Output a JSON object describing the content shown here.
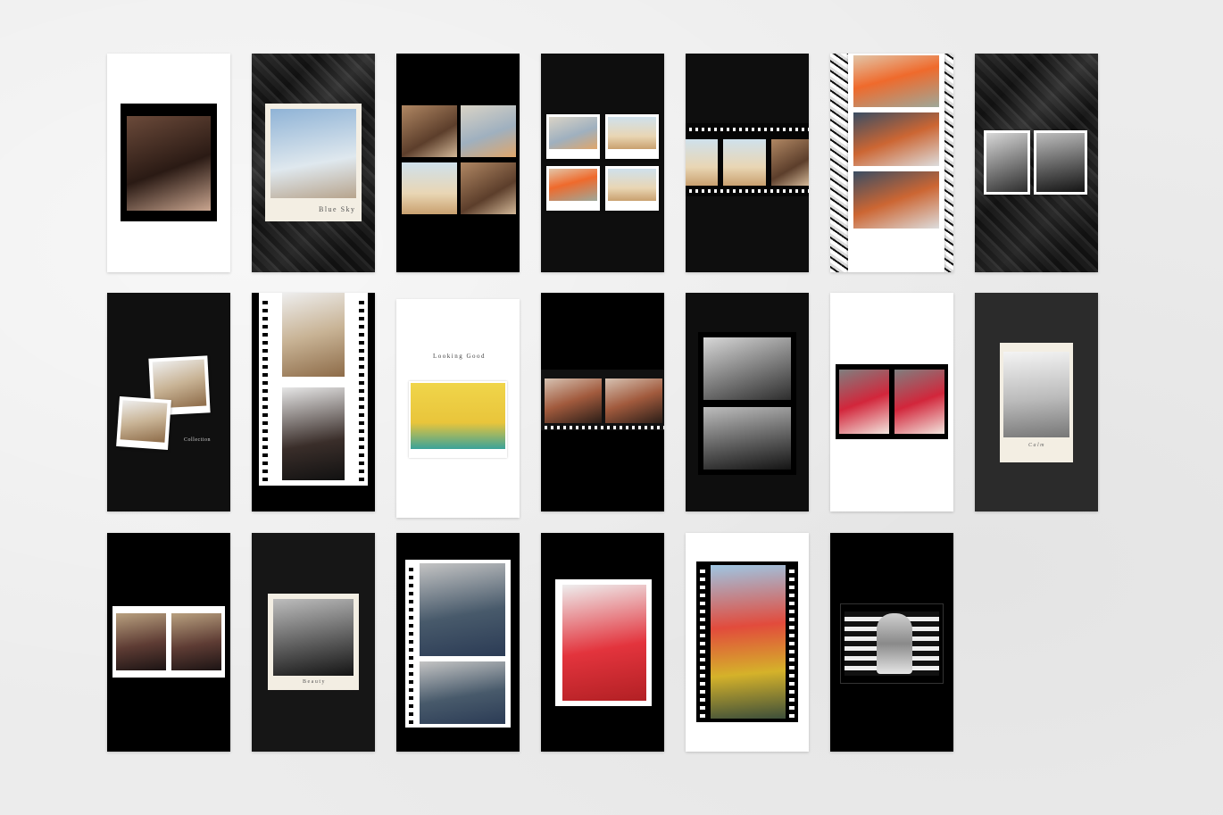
{
  "labels": {
    "blue_sky": "Blue Sky",
    "looking_good": "Looking Good",
    "collection": "Collection",
    "calm": "Calm",
    "beauty": "Beauty"
  },
  "colors": {
    "background": "#ececec",
    "tile_black": "#000000",
    "tile_charcoal": "#2b2b2b",
    "tile_white": "#ffffff",
    "frame_cream": "#f3eee3"
  }
}
